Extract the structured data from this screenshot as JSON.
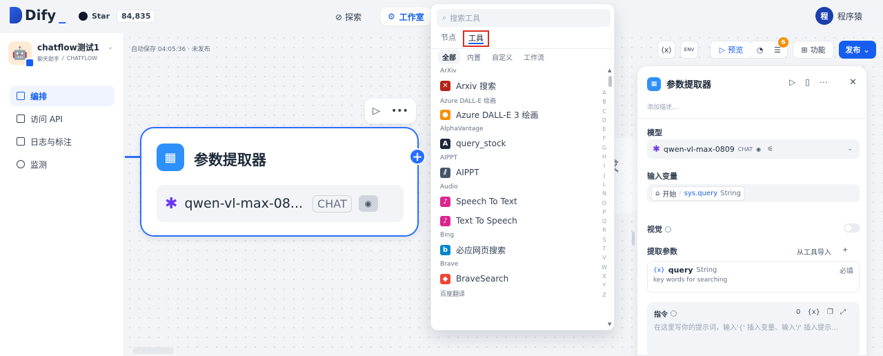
{
  "topbar": {
    "logo": "Dify",
    "github_star_label": "Star",
    "github_star_count": "84,835",
    "nav_explore": "探索",
    "nav_studio": "工作室",
    "user_avatar": "程",
    "user_name": "程序猿"
  },
  "app": {
    "name": "chatflow测试1",
    "mode": "聊天助手",
    "type": "CHATFLOW"
  },
  "sidebar": {
    "items": [
      {
        "label": "编排",
        "active": true
      },
      {
        "label": "访问 API",
        "active": false
      },
      {
        "label": "日志与标注",
        "active": false
      },
      {
        "label": "监测",
        "active": false
      }
    ]
  },
  "canvas": {
    "autosave": "自动保存 04:05:36 · 未发布",
    "node_title": "参数提取器",
    "node_model": "qwen-vl-max-08...",
    "node_model_tag": "CHAT",
    "ghost_title_fragment": "求"
  },
  "toolbar": {
    "preview": "预览",
    "checklist_count": "6",
    "features": "功能",
    "publish": "发布"
  },
  "dropdown": {
    "search_placeholder": "搜索工具",
    "tabs": [
      "节点",
      "工具"
    ],
    "subtabs": [
      "全部",
      "内置",
      "自定义",
      "工作流"
    ],
    "groups": [
      {
        "group": "ArXiv",
        "item": "Arxiv 搜索",
        "color": "#b42318"
      },
      {
        "group": "Azure DALL-E 绘画",
        "item": "Azure DALL-E 3 绘画",
        "color": "#f79009"
      },
      {
        "group": "AlphaVantage",
        "item": "query_stock",
        "color": "#1d2939"
      },
      {
        "group": "AIPPT",
        "item": "AIPPT",
        "color": "#475467"
      },
      {
        "group": "Audio",
        "item": "Speech To Text",
        "color": "#dd2590"
      },
      {
        "group": "",
        "item": "Text To Speech",
        "color": "#dd2590"
      },
      {
        "group": "Bing",
        "item": "必应网页搜索",
        "color": "#0086c9"
      },
      {
        "group": "Brave",
        "item": "BraveSearch",
        "color": "#f04438"
      },
      {
        "group": "百度翻译",
        "item": "",
        "color": ""
      }
    ],
    "alphabet": [
      "A",
      "B",
      "C",
      "D",
      "E",
      "F",
      "G",
      "H",
      "I",
      "J",
      "L",
      "N",
      "O",
      "P",
      "Q",
      "R",
      "S",
      "T",
      "V",
      "W",
      "X",
      "Y",
      "Z"
    ]
  },
  "panel": {
    "title": "参数提取器",
    "description_placeholder": "添加描述...",
    "model_label": "模型",
    "model_name": "qwen-vl-max-0809",
    "model_tag": "CHAT",
    "input_var_label": "输入变量",
    "input_var_node": "开始",
    "input_var_name": "sys.query",
    "input_var_type": "String",
    "vision_label": "视觉",
    "extract_label": "提取参数",
    "import_from_tool": "从工具导入",
    "param_name": "query",
    "param_type": "String",
    "param_required": "必填",
    "param_desc": "key words for searching",
    "instruction_label": "指令",
    "instruction_count": "0",
    "instruction_placeholder": "在这里写你的提示词，输入'{' 插入变量、输入'/' 插入提示..."
  }
}
